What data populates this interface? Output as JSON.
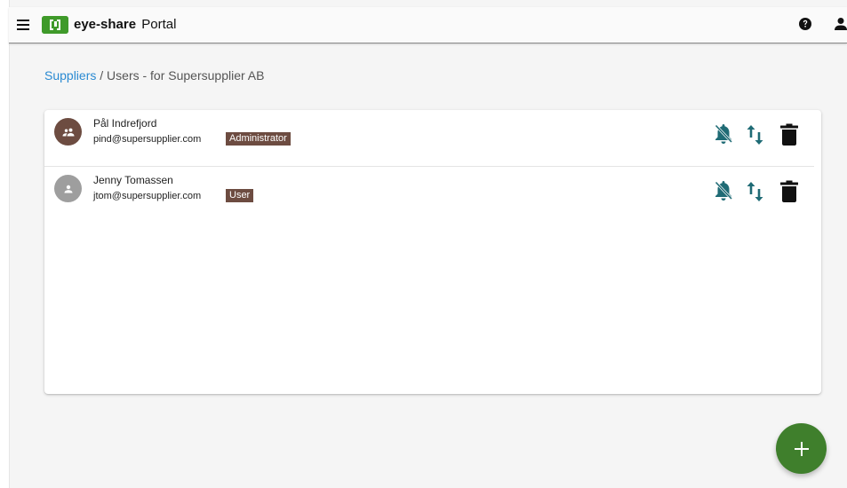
{
  "app": {
    "brand_main": "eye-share",
    "brand_sub": "Portal"
  },
  "breadcrumb": {
    "parent": "Suppliers",
    "separator": " / ",
    "current": "Users - for Supersupplier AB"
  },
  "users": [
    {
      "name": "Pål Indrefjord",
      "email": "pind@supersupplier.com",
      "role": "Administrator",
      "avatar_icon": "supervisor-account-icon",
      "avatar_color": "#6d4c41"
    },
    {
      "name": "Jenny Tomassen",
      "email": "jtom@supersupplier.com",
      "role": "User",
      "avatar_icon": "person-icon",
      "avatar_color": "#9e9e9e"
    }
  ],
  "colors": {
    "brand_green": "#3f9a2a",
    "link_blue": "#2a8ad2",
    "badge_brown": "#6d4c41",
    "action_teal": "#1f6b75",
    "fab_green": "#3f7f2c"
  }
}
